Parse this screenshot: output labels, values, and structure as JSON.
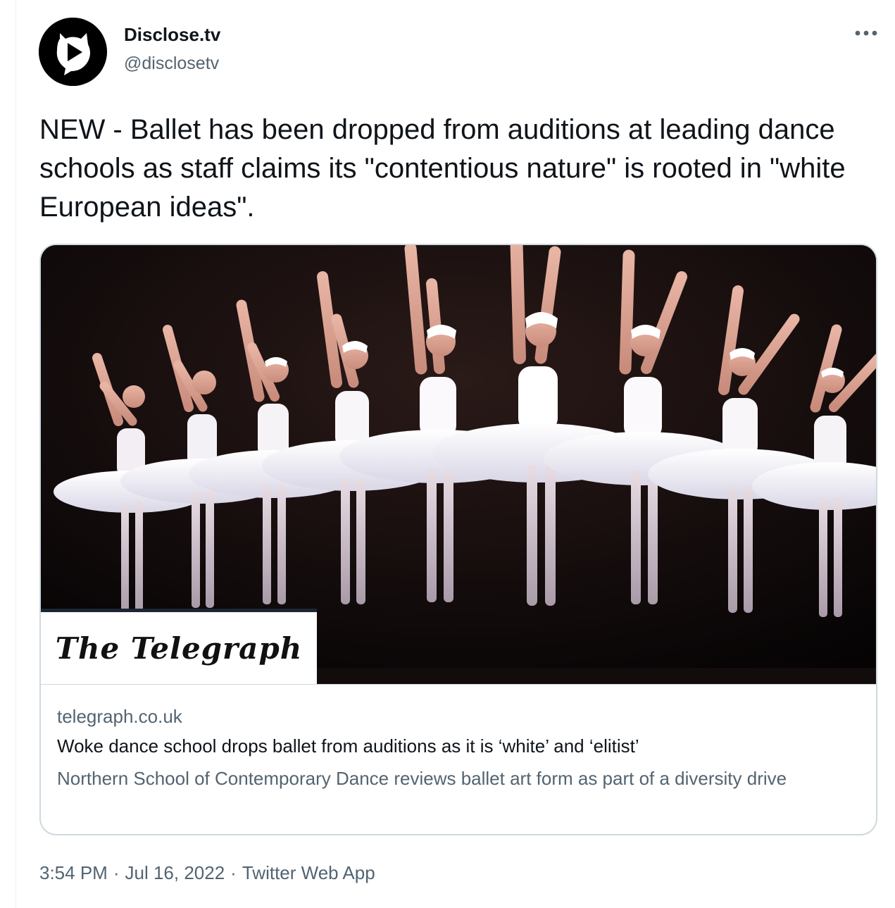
{
  "tweet": {
    "author": {
      "display_name": "Disclose.tv",
      "handle": "@disclosetv",
      "avatar_icon": "play-button-speech-bubble-icon"
    },
    "more_icon": "more-options-icon",
    "text": "NEW - Ballet has been dropped from auditions at leading dance schools as staff claims its \"contentious nature\" is rooted in \"white European ideas\".",
    "card": {
      "publisher_logo": "The Telegraph",
      "domain": "telegraph.co.uk",
      "title": "Woke dance school drops ballet from auditions as it is ‘white’ and ‘elitist’",
      "description": "Northern School of Contemporary Dance reviews ballet art form as part of a diversity drive"
    },
    "meta": {
      "time": "3:54 PM",
      "separator": "·",
      "date": "Jul 16, 2022",
      "source": "Twitter Web App"
    }
  }
}
